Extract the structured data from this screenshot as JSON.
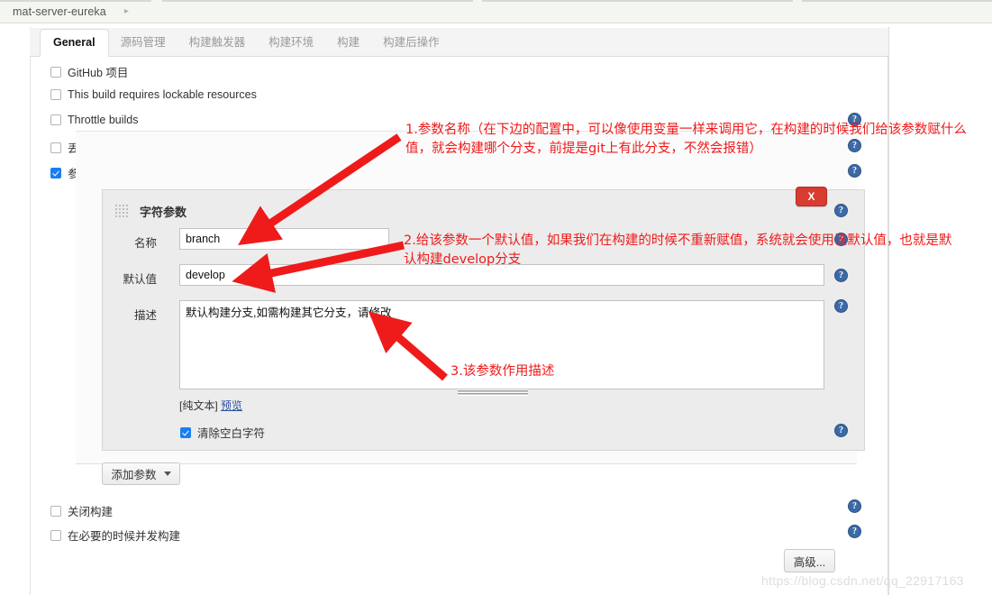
{
  "breadcrumb": {
    "project": "mat-server-eureka",
    "arrow_icon": "chevron-right-icon"
  },
  "tabs": [
    {
      "label": "General",
      "active": true
    },
    {
      "label": "源码管理",
      "active": false
    },
    {
      "label": "构建触发器",
      "active": false
    },
    {
      "label": "构建环境",
      "active": false
    },
    {
      "label": "构建",
      "active": false
    },
    {
      "label": "构建后操作",
      "active": false
    }
  ],
  "top_checkboxes": [
    {
      "label": "GitHub 项目",
      "checked": false
    },
    {
      "label": "This build requires lockable resources",
      "checked": false
    },
    {
      "label": "Throttle builds",
      "checked": false
    },
    {
      "label": "丢弃旧的构建",
      "checked": false
    },
    {
      "label": "参数化构建过程",
      "checked": true
    }
  ],
  "param_panel": {
    "title": "字符参数",
    "delete_label": "X",
    "drag_handle_icon": "drag-grip-icon",
    "fields": {
      "name_label": "名称",
      "name_value": "branch",
      "default_label": "默认值",
      "default_value": "develop",
      "desc_label": "描述",
      "desc_value": "默认构建分支,如需构建其它分支，请修改"
    },
    "plain_text_tag": "[纯文本]",
    "preview_link": "预览",
    "trim_checkbox": {
      "label": "清除空白字符",
      "checked": true
    }
  },
  "add_param_button": {
    "label": "添加参数",
    "caret_icon": "caret-down-icon"
  },
  "bottom_checkboxes": [
    {
      "label": "关闭构建",
      "checked": false
    },
    {
      "label": "在必要的时候并发构建",
      "checked": false
    }
  ],
  "advanced_button": {
    "label": "高级..."
  },
  "help_icon_glyph": "?",
  "annotations": [
    {
      "id": "anno-1",
      "text": "1.参数名称（在下边的配置中，可以像使用变量一样来调用它，在构建的时候我们给该参数赋什么值，就会构建哪个分支，前提是git上有此分支，不然会报错）"
    },
    {
      "id": "anno-2",
      "text": "2.给该参数一个默认值，如果我们在构建的时候不重新赋值，系统就会使用该默认值，也就是默认构建develop分支"
    },
    {
      "id": "anno-3",
      "text": "3.该参数作用描述"
    }
  ],
  "watermark": {
    "text": "https://blog.csdn.net/qq_22917163"
  },
  "colors": {
    "annotation_red": "#ef1a1a",
    "delete_red": "#d93b30",
    "accent_blue": "#1a7ef2",
    "help_blue": "#3c6aa8"
  }
}
